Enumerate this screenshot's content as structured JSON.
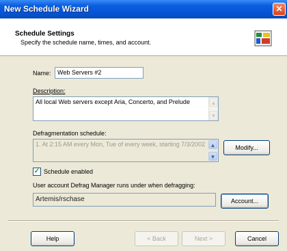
{
  "window": {
    "title": "New Schedule Wizard"
  },
  "header": {
    "title": "Schedule Settings",
    "subtitle": "Specify the schedule name, times, and account."
  },
  "form": {
    "name_label": "Name:",
    "name_value": "Web Servers #2",
    "description_label": "Description:",
    "description_value": "All local Web servers except Aria, Concerto, and Prelude",
    "schedule_label": "Defragmentation schedule:",
    "schedule_value": "1. At 2:15 AM every Mon, Tue of every week, starting 7/3/2002",
    "modify_label": "Modify...",
    "enabled_label": "Schedule enabled",
    "enabled_checked": true,
    "account_label": "User account Defrag Manager runs under when defragging:",
    "account_value": "Artemis/rschase",
    "account_button": "Account..."
  },
  "footer": {
    "help": "Help",
    "back": "< Back",
    "next": "Next >",
    "cancel": "Cancel"
  }
}
